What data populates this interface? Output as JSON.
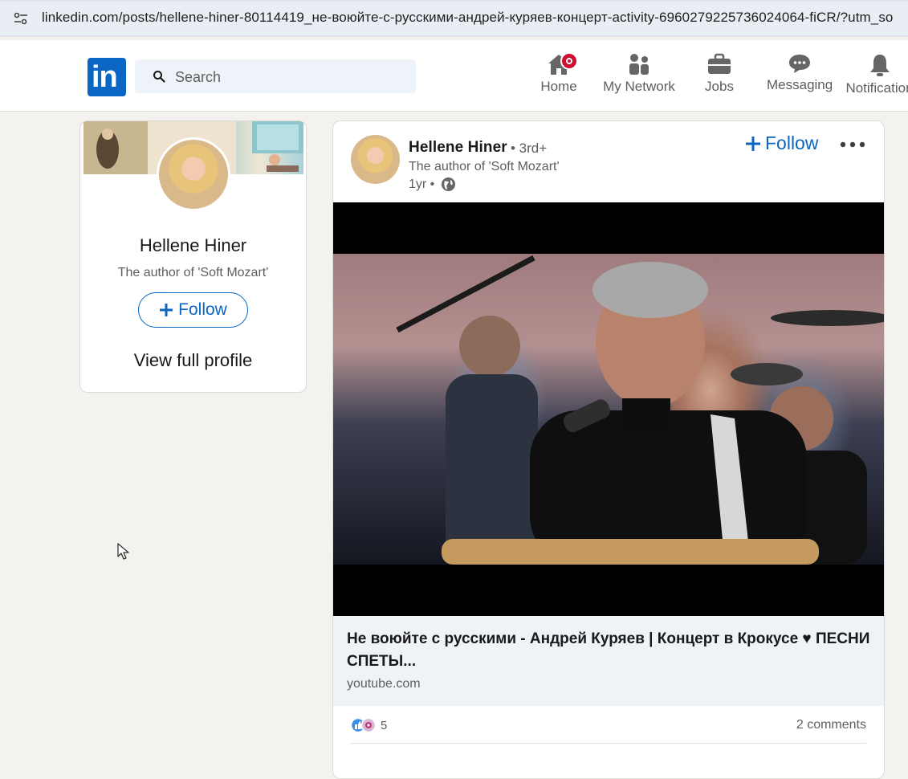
{
  "browser": {
    "url": "linkedin.com/posts/hellene-hiner-80114419_не-воюйте-с-русскими-андрей-куряев-концерт-activity-6960279225736024064-fiCR/?utm_so"
  },
  "header": {
    "logo_text": "in",
    "search_placeholder": "Search",
    "nav": [
      {
        "label": "Home",
        "icon": "home-icon"
      },
      {
        "label": "My Network",
        "icon": "network-icon"
      },
      {
        "label": "Jobs",
        "icon": "briefcase-icon"
      },
      {
        "label": "Messaging",
        "icon": "chat-icon"
      },
      {
        "label": "Notification",
        "icon": "bell-icon"
      }
    ],
    "brand_color": "#0a66c2",
    "badge_color": "#cb112d"
  },
  "profile_card": {
    "name": "Hellene Hiner",
    "headline": "The author of 'Soft Mozart'",
    "follow_label": "Follow",
    "view_profile_label": "View full profile"
  },
  "post": {
    "author_name": "Hellene Hiner",
    "degree": "• 3rd+",
    "headline": "The author of 'Soft Mozart'",
    "time": "1yr •",
    "follow_label": "Follow",
    "link_title": "Не воюйте с русскими - Андрей Куряев | Концерт в Крокусе ♥ ПЕСНИ СПЕТЫ...",
    "link_domain": "youtube.com",
    "reactions_count": "5",
    "comments_count": "2 comments"
  }
}
